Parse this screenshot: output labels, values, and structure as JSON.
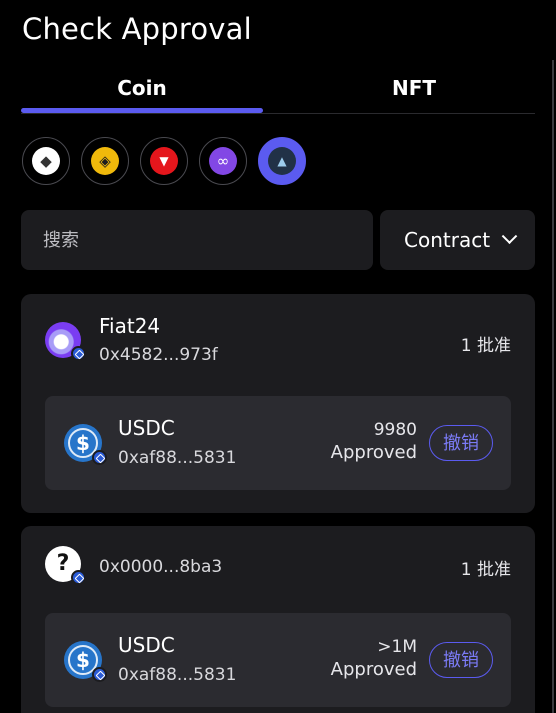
{
  "title": "Check Approval",
  "tabs": [
    {
      "label": "Coin",
      "active": true
    },
    {
      "label": "NFT",
      "active": false
    }
  ],
  "chains": [
    {
      "name": "ethereum-icon",
      "glyph": "◆",
      "bg": "#ffffff",
      "fg": "#333333"
    },
    {
      "name": "bnb-icon",
      "glyph": "◈",
      "bg": "#f0b90b",
      "fg": "#1c1c1f"
    },
    {
      "name": "tron-icon",
      "glyph": "▼",
      "bg": "#e5161c",
      "fg": "#ffffff"
    },
    {
      "name": "polygon-icon",
      "glyph": "∞",
      "bg": "#8247e5",
      "fg": "#ffffff"
    },
    {
      "name": "arbitrum-icon",
      "glyph": "▲",
      "bg": "#213147",
      "fg": "#9dcced"
    }
  ],
  "search": {
    "placeholder": "搜索"
  },
  "filter": {
    "selected": "Contract"
  },
  "accent": "#5b5bf0",
  "cards": [
    {
      "owner_name": "Fiat24",
      "owner_addr": "0x4582...973f",
      "approvals": "1 批准",
      "token": {
        "name": "USDC",
        "addr": "0xaf88...5831",
        "amount": "9980",
        "status": "Approved",
        "revoke": "撤销"
      }
    },
    {
      "owner_name": "",
      "owner_addr": "0x0000...8ba3",
      "approvals": "1 批准",
      "token": {
        "name": "USDC",
        "addr": "0xaf88...5831",
        "amount": ">1M",
        "status": "Approved",
        "revoke": "撤销"
      }
    }
  ]
}
